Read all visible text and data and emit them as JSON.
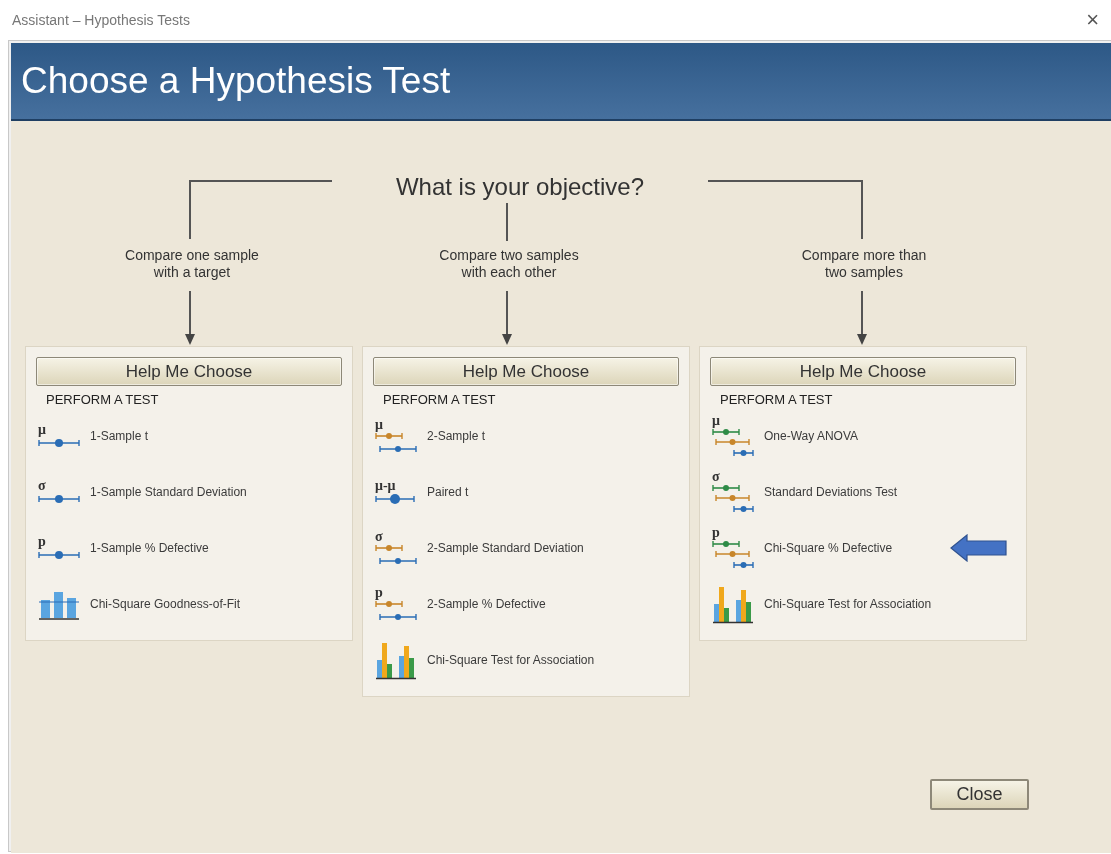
{
  "window": {
    "title": "Assistant – Hypothesis Tests",
    "close": "×"
  },
  "header": {
    "title": "Choose a Hypothesis Test"
  },
  "objective": "What is your objective?",
  "columns": [
    {
      "label": "Compare one sample\nwith a target",
      "button": "Help Me Choose",
      "section": "PERFORM A TEST",
      "items": [
        {
          "symbol": "μ",
          "kind": "single",
          "label": "1-Sample t",
          "marked": false
        },
        {
          "symbol": "σ",
          "kind": "single",
          "label": "1-Sample Standard Deviation",
          "marked": false
        },
        {
          "symbol": "p",
          "kind": "single",
          "label": "1-Sample % Defective",
          "marked": false
        },
        {
          "kind": "bars-single",
          "label": "Chi-Square Goodness-of-Fit",
          "marked": false
        }
      ]
    },
    {
      "label": "Compare two samples\nwith each other",
      "button": "Help Me Choose",
      "section": "PERFORM A TEST",
      "items": [
        {
          "symbol": "μ",
          "kind": "double",
          "label": "2-Sample t",
          "marked": false
        },
        {
          "symbol": "μ-μ",
          "kind": "paired",
          "label": "Paired t",
          "marked": false
        },
        {
          "symbol": "σ",
          "kind": "double",
          "label": "2-Sample Standard Deviation",
          "marked": false
        },
        {
          "symbol": "p",
          "kind": "double",
          "label": "2-Sample % Defective",
          "marked": false
        },
        {
          "kind": "bars-color",
          "label": "Chi-Square Test for Association",
          "marked": false
        }
      ]
    },
    {
      "label": "Compare more than\ntwo samples",
      "button": "Help Me Choose",
      "section": "PERFORM A TEST",
      "items": [
        {
          "symbol": "μ",
          "kind": "triple",
          "label": "One-Way ANOVA",
          "marked": false
        },
        {
          "symbol": "σ",
          "kind": "triple",
          "label": "Standard Deviations Test",
          "marked": false
        },
        {
          "symbol": "p",
          "kind": "triple",
          "label": "Chi-Square % Defective",
          "marked": true
        },
        {
          "kind": "bars-color",
          "label": "Chi-Square Test for Association",
          "marked": false
        }
      ]
    }
  ],
  "buttons": [
    "Close"
  ]
}
